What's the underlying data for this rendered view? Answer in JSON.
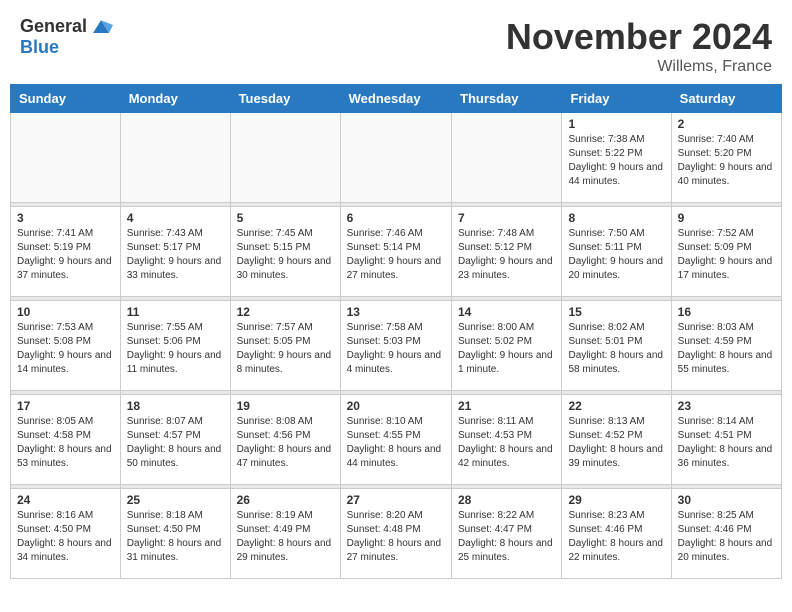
{
  "header": {
    "logo_general": "General",
    "logo_blue": "Blue",
    "month_title": "November 2024",
    "location": "Willems, France"
  },
  "days_of_week": [
    "Sunday",
    "Monday",
    "Tuesday",
    "Wednesday",
    "Thursday",
    "Friday",
    "Saturday"
  ],
  "weeks": [
    [
      {
        "day": "",
        "info": ""
      },
      {
        "day": "",
        "info": ""
      },
      {
        "day": "",
        "info": ""
      },
      {
        "day": "",
        "info": ""
      },
      {
        "day": "",
        "info": ""
      },
      {
        "day": "1",
        "info": "Sunrise: 7:38 AM\nSunset: 5:22 PM\nDaylight: 9 hours and 44 minutes."
      },
      {
        "day": "2",
        "info": "Sunrise: 7:40 AM\nSunset: 5:20 PM\nDaylight: 9 hours and 40 minutes."
      }
    ],
    [
      {
        "day": "3",
        "info": "Sunrise: 7:41 AM\nSunset: 5:19 PM\nDaylight: 9 hours and 37 minutes."
      },
      {
        "day": "4",
        "info": "Sunrise: 7:43 AM\nSunset: 5:17 PM\nDaylight: 9 hours and 33 minutes."
      },
      {
        "day": "5",
        "info": "Sunrise: 7:45 AM\nSunset: 5:15 PM\nDaylight: 9 hours and 30 minutes."
      },
      {
        "day": "6",
        "info": "Sunrise: 7:46 AM\nSunset: 5:14 PM\nDaylight: 9 hours and 27 minutes."
      },
      {
        "day": "7",
        "info": "Sunrise: 7:48 AM\nSunset: 5:12 PM\nDaylight: 9 hours and 23 minutes."
      },
      {
        "day": "8",
        "info": "Sunrise: 7:50 AM\nSunset: 5:11 PM\nDaylight: 9 hours and 20 minutes."
      },
      {
        "day": "9",
        "info": "Sunrise: 7:52 AM\nSunset: 5:09 PM\nDaylight: 9 hours and 17 minutes."
      }
    ],
    [
      {
        "day": "10",
        "info": "Sunrise: 7:53 AM\nSunset: 5:08 PM\nDaylight: 9 hours and 14 minutes."
      },
      {
        "day": "11",
        "info": "Sunrise: 7:55 AM\nSunset: 5:06 PM\nDaylight: 9 hours and 11 minutes."
      },
      {
        "day": "12",
        "info": "Sunrise: 7:57 AM\nSunset: 5:05 PM\nDaylight: 9 hours and 8 minutes."
      },
      {
        "day": "13",
        "info": "Sunrise: 7:58 AM\nSunset: 5:03 PM\nDaylight: 9 hours and 4 minutes."
      },
      {
        "day": "14",
        "info": "Sunrise: 8:00 AM\nSunset: 5:02 PM\nDaylight: 9 hours and 1 minute."
      },
      {
        "day": "15",
        "info": "Sunrise: 8:02 AM\nSunset: 5:01 PM\nDaylight: 8 hours and 58 minutes."
      },
      {
        "day": "16",
        "info": "Sunrise: 8:03 AM\nSunset: 4:59 PM\nDaylight: 8 hours and 55 minutes."
      }
    ],
    [
      {
        "day": "17",
        "info": "Sunrise: 8:05 AM\nSunset: 4:58 PM\nDaylight: 8 hours and 53 minutes."
      },
      {
        "day": "18",
        "info": "Sunrise: 8:07 AM\nSunset: 4:57 PM\nDaylight: 8 hours and 50 minutes."
      },
      {
        "day": "19",
        "info": "Sunrise: 8:08 AM\nSunset: 4:56 PM\nDaylight: 8 hours and 47 minutes."
      },
      {
        "day": "20",
        "info": "Sunrise: 8:10 AM\nSunset: 4:55 PM\nDaylight: 8 hours and 44 minutes."
      },
      {
        "day": "21",
        "info": "Sunrise: 8:11 AM\nSunset: 4:53 PM\nDaylight: 8 hours and 42 minutes."
      },
      {
        "day": "22",
        "info": "Sunrise: 8:13 AM\nSunset: 4:52 PM\nDaylight: 8 hours and 39 minutes."
      },
      {
        "day": "23",
        "info": "Sunrise: 8:14 AM\nSunset: 4:51 PM\nDaylight: 8 hours and 36 minutes."
      }
    ],
    [
      {
        "day": "24",
        "info": "Sunrise: 8:16 AM\nSunset: 4:50 PM\nDaylight: 8 hours and 34 minutes."
      },
      {
        "day": "25",
        "info": "Sunrise: 8:18 AM\nSunset: 4:50 PM\nDaylight: 8 hours and 31 minutes."
      },
      {
        "day": "26",
        "info": "Sunrise: 8:19 AM\nSunset: 4:49 PM\nDaylight: 8 hours and 29 minutes."
      },
      {
        "day": "27",
        "info": "Sunrise: 8:20 AM\nSunset: 4:48 PM\nDaylight: 8 hours and 27 minutes."
      },
      {
        "day": "28",
        "info": "Sunrise: 8:22 AM\nSunset: 4:47 PM\nDaylight: 8 hours and 25 minutes."
      },
      {
        "day": "29",
        "info": "Sunrise: 8:23 AM\nSunset: 4:46 PM\nDaylight: 8 hours and 22 minutes."
      },
      {
        "day": "30",
        "info": "Sunrise: 8:25 AM\nSunset: 4:46 PM\nDaylight: 8 hours and 20 minutes."
      }
    ]
  ]
}
